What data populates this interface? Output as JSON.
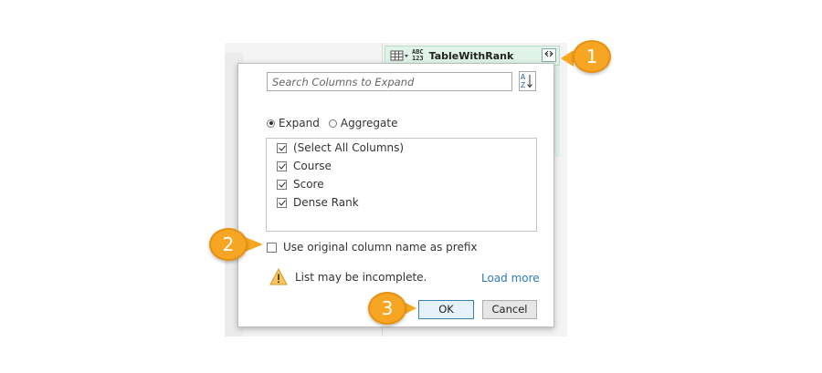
{
  "column_header": {
    "type_label_top": "ABC",
    "type_label_bottom": "123",
    "name": "TableWithRank",
    "expand_icon": "expand-columns-icon"
  },
  "dialog": {
    "search": {
      "placeholder": "Search Columns to Expand",
      "value": ""
    },
    "sort_button_icon": "sort-az-icon",
    "sort_label_top": "A",
    "sort_label_bottom": "Z",
    "mode": {
      "expand_label": "Expand",
      "aggregate_label": "Aggregate",
      "selected": "expand"
    },
    "columns": [
      {
        "label": "(Select All Columns)",
        "checked": true
      },
      {
        "label": "Course",
        "checked": true
      },
      {
        "label": "Score",
        "checked": true
      },
      {
        "label": "Dense Rank",
        "checked": true
      }
    ],
    "prefix": {
      "label": "Use original column name as prefix",
      "checked": false
    },
    "warning": {
      "text": "List may be incomplete.",
      "icon": "warning-icon"
    },
    "load_more_label": "Load more",
    "ok_label": "OK",
    "cancel_label": "Cancel"
  },
  "callouts": [
    "1",
    "2",
    "3"
  ],
  "colors": {
    "callout": "#f6a623",
    "header_green": "#dff3e8",
    "link": "#2b7bb9",
    "ok_border": "#3c7fb1"
  }
}
